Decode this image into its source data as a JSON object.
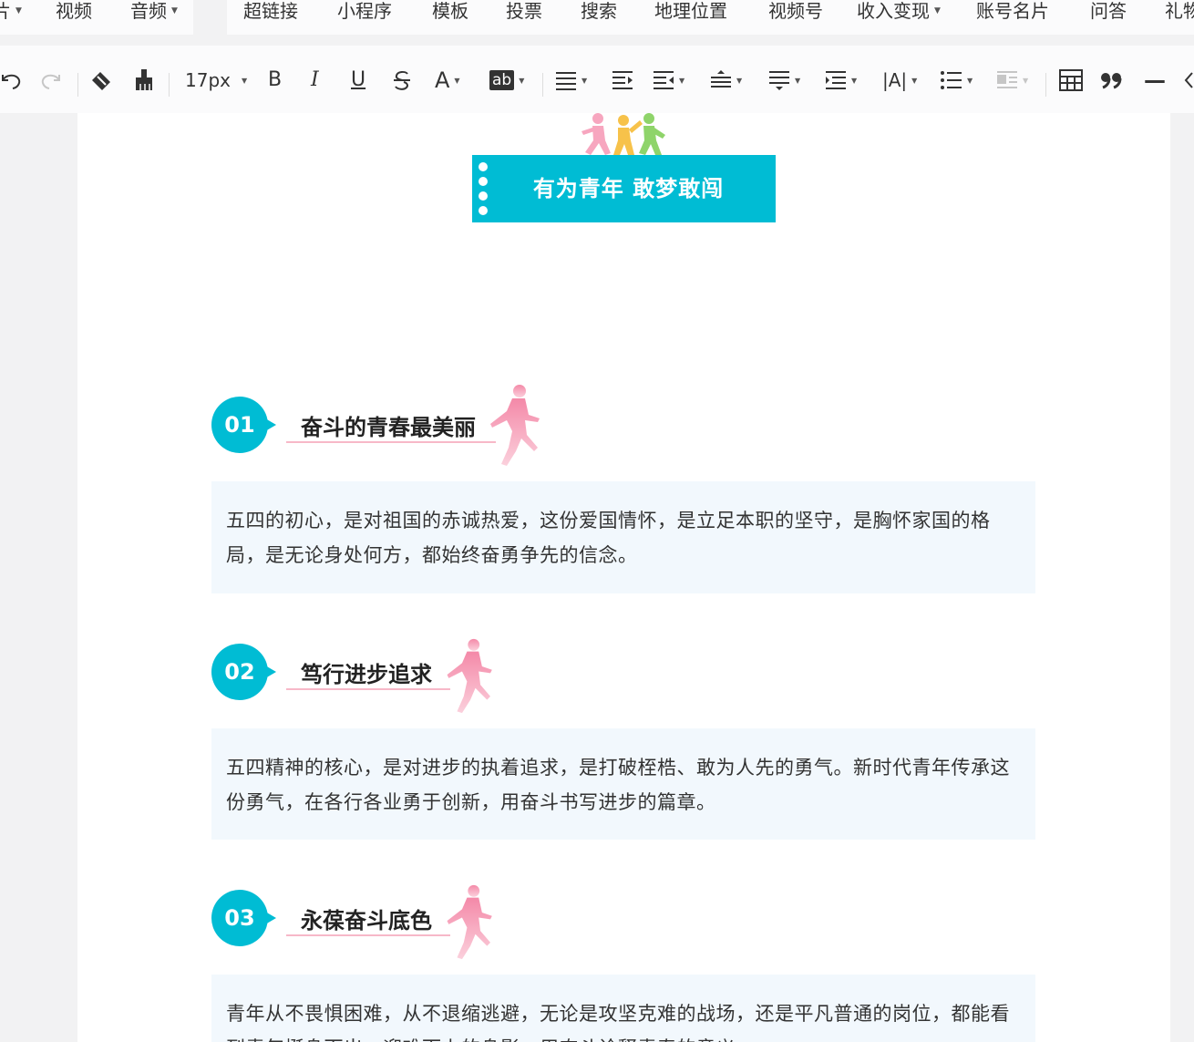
{
  "menu": {
    "items": [
      {
        "label": "片",
        "caret": true
      },
      {
        "label": "视频",
        "caret": false
      },
      {
        "label": "音频",
        "caret": true
      },
      {
        "label": "超链接",
        "caret": false
      },
      {
        "label": "小程序",
        "caret": false
      },
      {
        "label": "模板",
        "caret": false
      },
      {
        "label": "投票",
        "caret": false
      },
      {
        "label": "搜索",
        "caret": false
      },
      {
        "label": "地理位置",
        "caret": false
      },
      {
        "label": "视频号",
        "caret": false
      },
      {
        "label": "收入变现",
        "caret": true
      },
      {
        "label": "账号名片",
        "caret": false
      },
      {
        "label": "问答",
        "caret": false
      },
      {
        "label": "礼物",
        "caret": false
      }
    ]
  },
  "toolbar": {
    "font_size": "17px",
    "bold_label": "B",
    "italic_label": "I",
    "underline_label": "U",
    "font_color_label": "A",
    "highlight_label": "ab",
    "letter_spacing_label": "|A|",
    "divider_label": "—"
  },
  "document": {
    "banner_title": "有为青年 敢梦敢闯",
    "sections": [
      {
        "number": "01",
        "title": "奋斗的青春最美丽",
        "body": "五四的初心，是对祖国的赤诚热爱，这份爱国情怀，是立足本职的坚守，是胸怀家国的格局，是无论身处何方，都始终奋勇争先的信念。"
      },
      {
        "number": "02",
        "title": "笃行进步追求",
        "body": "五四精神的核心，是对进步的执着追求，是打破桎梏、敢为人先的勇气。新时代青年传承这份勇气，在各行各业勇于创新，用奋斗书写进步的篇章。"
      },
      {
        "number": "03",
        "title": "永葆奋斗底色",
        "body": "青年从不畏惧困难，从不退缩逃避，无论是攻坚克难的战场，还是平凡普通的岗位，都能看到青年挺身而出、迎难而上的身影，用奋斗诠释青春的意义。"
      }
    ]
  },
  "colors": {
    "accent": "#00bcd4",
    "box_bg": "#f2f8fd",
    "pink": "#f7a6bf"
  }
}
